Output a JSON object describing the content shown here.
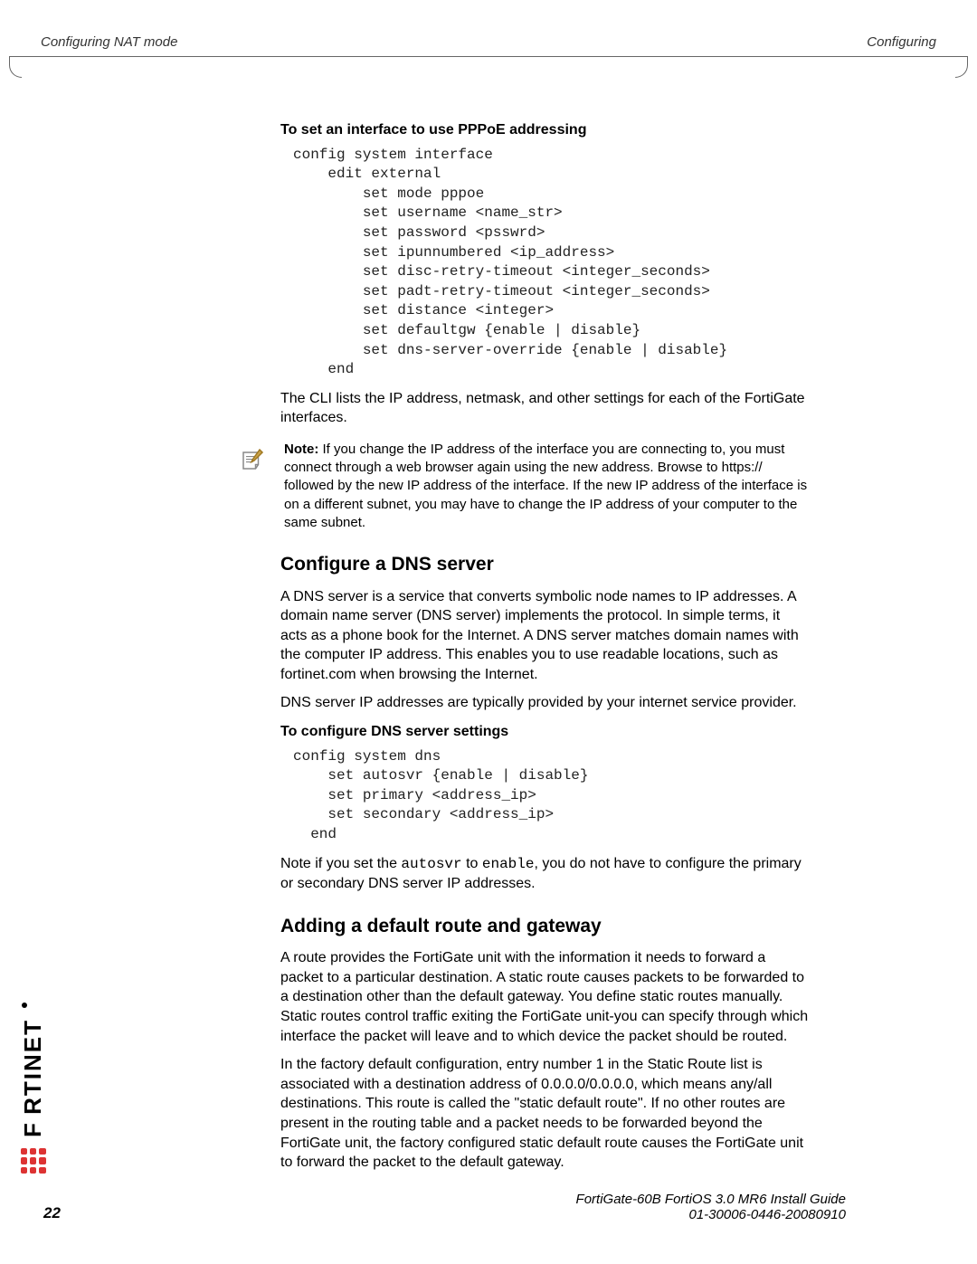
{
  "header": {
    "left": "Configuring NAT mode",
    "right": "Configuring"
  },
  "section1": {
    "heading": "To set an interface to use PPPoE addressing",
    "code": "config system interface\n    edit external\n        set mode pppoe\n        set username <name_str>\n        set password <psswrd>\n        set ipunnumbered <ip_address>\n        set disc-retry-timeout <integer_seconds>\n        set padt-retry-timeout <integer_seconds>\n        set distance <integer>\n        set defaultgw {enable | disable}\n        set dns-server-override {enable | disable}\n    end",
    "after": "The CLI lists the IP address, netmask, and other settings for each of the FortiGate interfaces."
  },
  "note": {
    "label": "Note:",
    "text": " If you change the IP address of the interface you are connecting to, you must connect through a web browser again using the new address. Browse to https:// followed by the new IP address of the interface. If the new IP address of the interface is on a different subnet, you may have to change the IP address of your computer to the same subnet."
  },
  "section2": {
    "title": "Configure a DNS server",
    "p1": "A DNS server is a service that converts symbolic node names to IP addresses. A domain name server (DNS server) implements the protocol. In simple terms, it acts as a phone book for the Internet. A DNS server matches domain names with the computer IP address. This enables you to use readable locations, such as fortinet.com when browsing the Internet.",
    "p2": "DNS server IP addresses are typically provided by your internet service provider.",
    "proc_heading": "To configure DNS server settings",
    "code": "config system dns\n    set autosvr {enable | disable}\n    set primary <address_ip>\n    set secondary <address_ip>\n  end",
    "after_pre": "Note if you set the ",
    "mono1": "autosvr",
    "after_mid": " to ",
    "mono2": "enable",
    "after_post": ", you do not have to configure the primary or secondary DNS server IP addresses."
  },
  "section3": {
    "title": "Adding a default route and gateway",
    "p1": "A route provides the FortiGate unit with the information it needs to forward a packet to a particular destination. A static route causes packets to be forwarded to a destination other than the default gateway. You define static routes manually. Static routes control traffic exiting the FortiGate unit-you can specify through which interface the packet will leave and to which device the packet should be routed.",
    "p2": "In the factory default configuration, entry number 1 in the Static Route list is associated with a destination address of 0.0.0.0/0.0.0.0, which means any/all destinations. This route is called the \"static default route\". If no other routes are present in the routing table and a packet needs to be forwarded beyond the FortiGate unit, the factory configured static default route causes the FortiGate unit to forward the packet to the default gateway."
  },
  "logo": {
    "text": "F RTINET"
  },
  "footer": {
    "page": "22",
    "line1": "FortiGate-60B FortiOS 3.0 MR6 Install Guide",
    "line2": "01-30006-0446-20080910"
  }
}
